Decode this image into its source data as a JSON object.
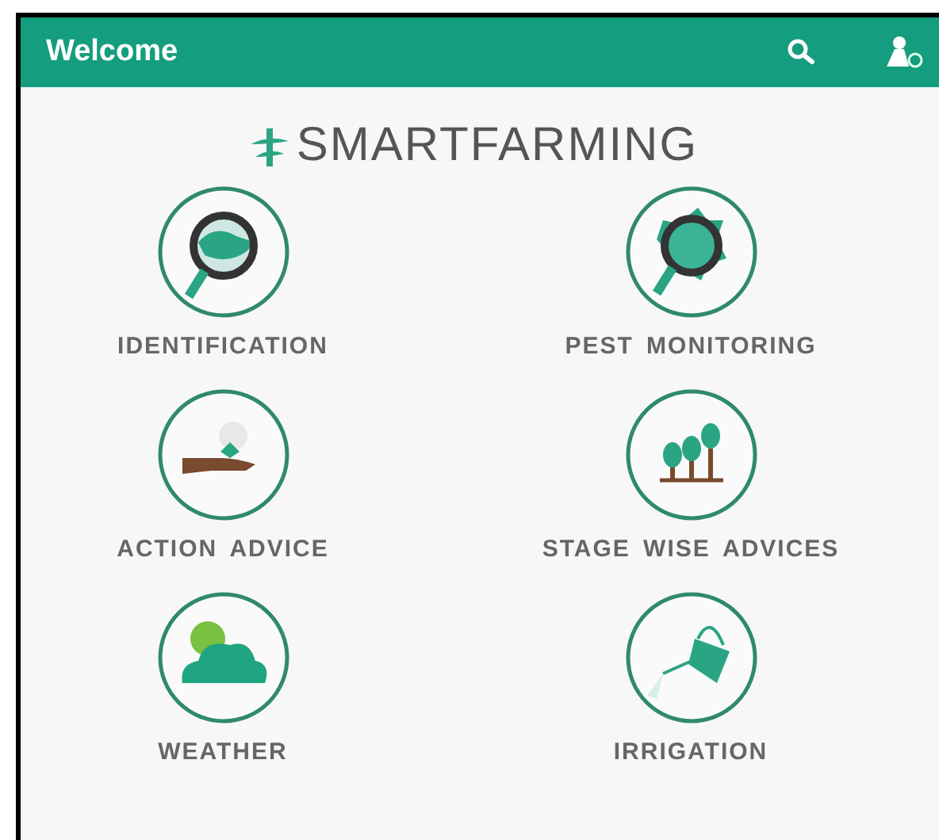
{
  "app_bar": {
    "title": "Welcome"
  },
  "logo": {
    "text": "SMARTFARMING"
  },
  "menu": [
    {
      "kind": "identification",
      "label": "IDENTIFICATION"
    },
    {
      "kind": "pest",
      "label": "PEST MONITORING"
    },
    {
      "kind": "action",
      "label": "ACTION ADVICE"
    },
    {
      "kind": "stage",
      "label": "STAGE WISE ADVICES"
    },
    {
      "kind": "weather",
      "label": "WEATHER"
    },
    {
      "kind": "irrigation",
      "label": "IRRIGATION"
    }
  ]
}
